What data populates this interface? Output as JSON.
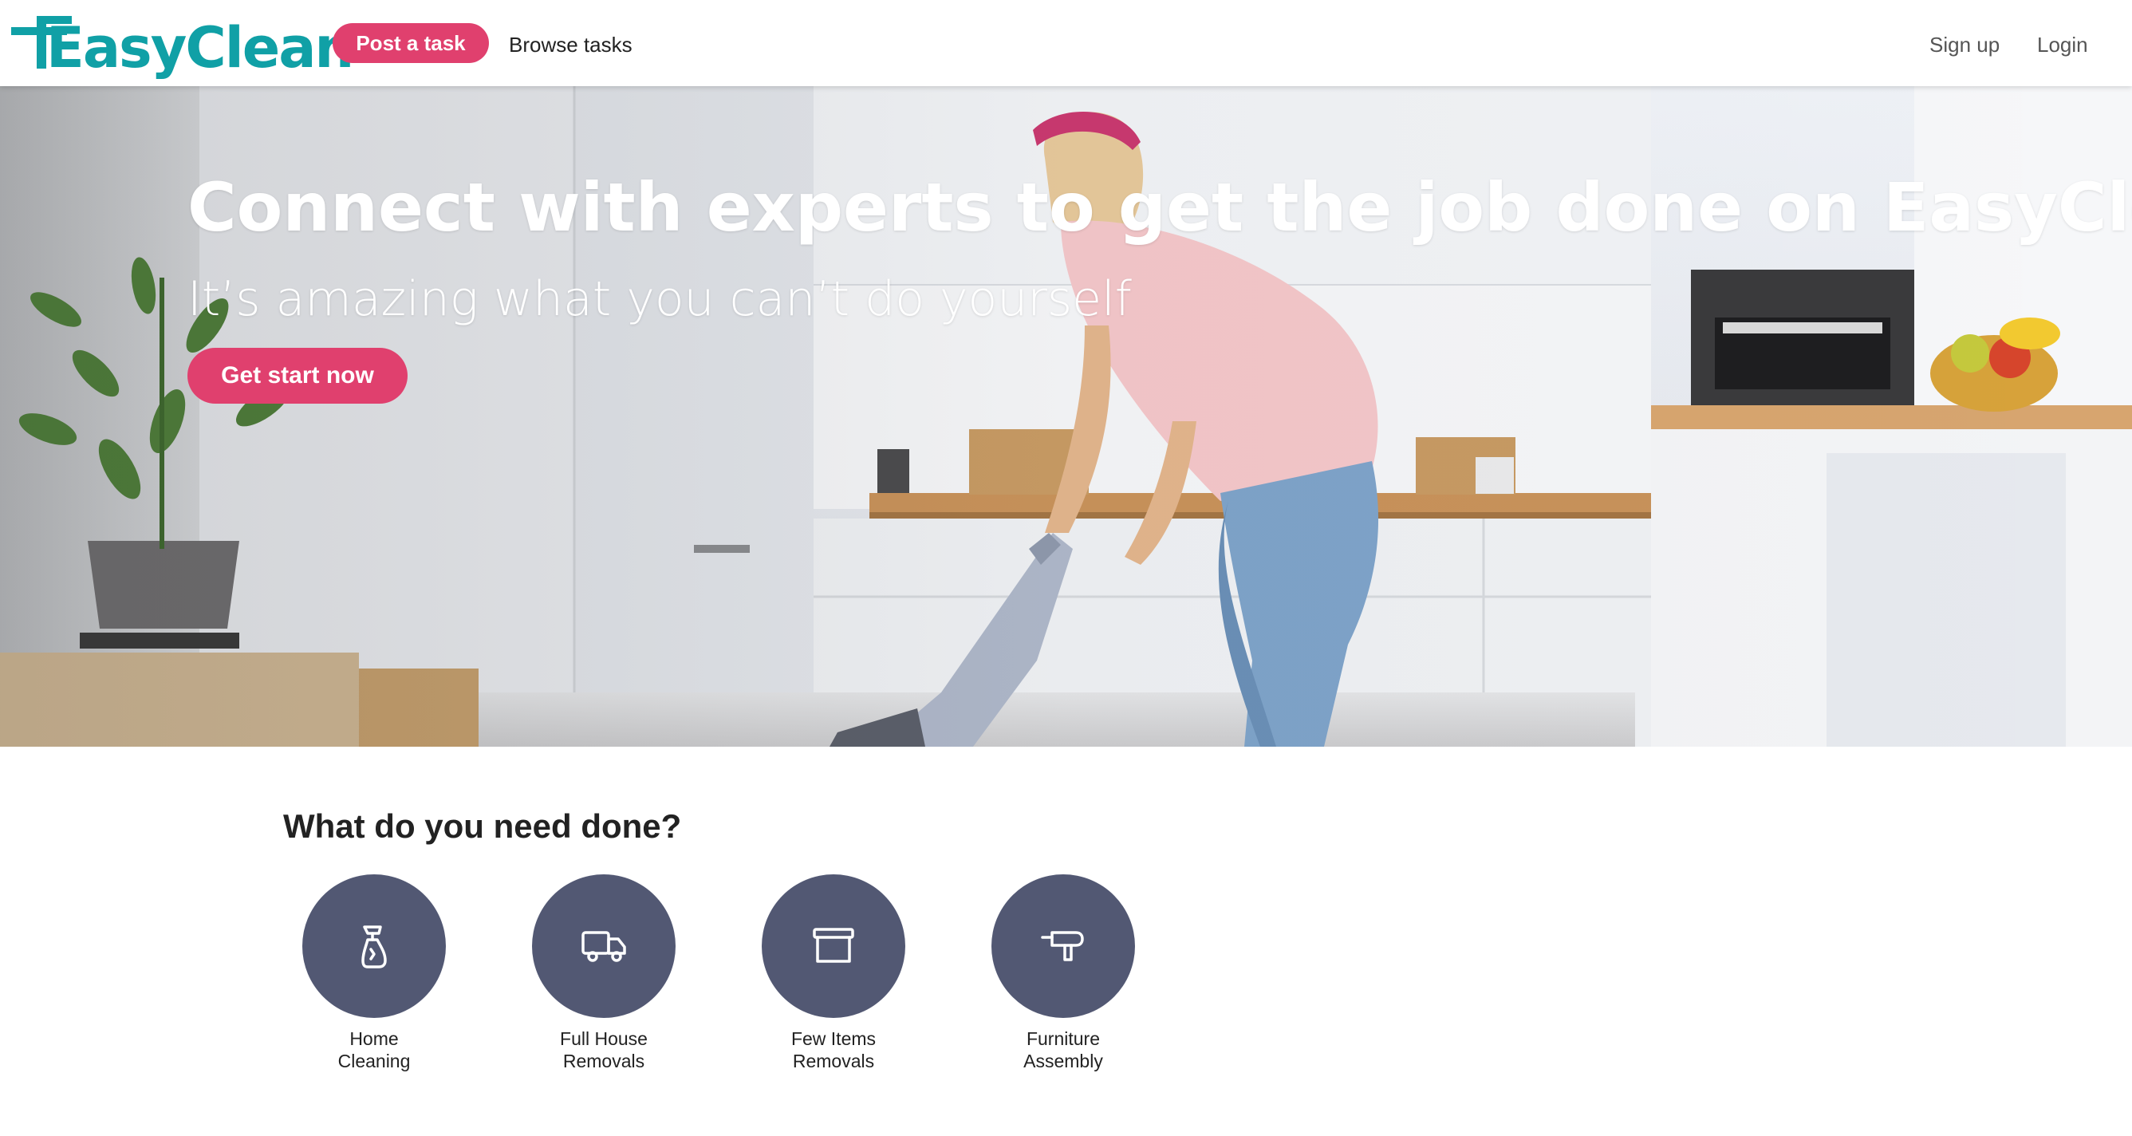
{
  "nav": {
    "brand": "EasyClean",
    "post_task": "Post a task",
    "browse_tasks": "Browse tasks",
    "sign_up": "Sign up",
    "login": "Login"
  },
  "hero": {
    "title": "Connect with experts to get the job done on EasyClean",
    "subtitle": "It’s amazing what you can’t do yourself",
    "cta": "Get start now"
  },
  "services": {
    "heading": "What do you need done?",
    "items": [
      {
        "label_line1": "Home",
        "label_line2": "Cleaning",
        "icon": "spray-bottle-icon"
      },
      {
        "label_line1": "Full House",
        "label_line2": "Removals",
        "icon": "truck-icon"
      },
      {
        "label_line1": "Few Items",
        "label_line2": "Removals",
        "icon": "box-icon"
      },
      {
        "label_line1": "Furniture",
        "label_line2": "Assembly",
        "icon": "drill-icon"
      }
    ]
  },
  "colors": {
    "brand_teal": "#10a0a6",
    "accent_pink": "#e0406e",
    "icon_circle": "#525873"
  }
}
